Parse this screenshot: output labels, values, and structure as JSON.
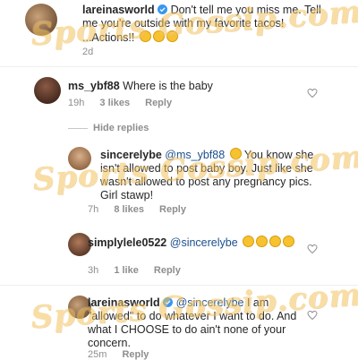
{
  "comments": [
    {
      "username": "lareinasworld",
      "text": "Don't tell me you miss me. Tell me you're outside with my favorite tacos! ...Actions!!",
      "time": "2d"
    },
    {
      "username": "ms_ybf88",
      "text": "Where is the baby",
      "time": "19h",
      "likes": "3 likes",
      "reply": "Reply"
    }
  ],
  "hide_replies": "Hide replies",
  "replies": [
    {
      "username": "sincerelybe",
      "mention": "@ms_ybf88",
      "text": "You know she isn't allowed to post baby boy. Just like she wasn't allowed to post any pregnancy pics. Girl stawp!",
      "time": "7h",
      "likes": "8 likes",
      "reply": "Reply"
    },
    {
      "username": "simplylele0522",
      "mention": "@sincerelybe",
      "time": "3h",
      "likes": "1 like",
      "reply": "Reply"
    },
    {
      "username": "lareinasworld",
      "mention": "@sincerelybe",
      "text": "I am \"allowed\" to do whatever I want to do. And what I CHOOSE to do ain't none of your concern.",
      "time": "25m",
      "reply": "Reply"
    }
  ],
  "watermark": "Sports Gossip.com",
  "icons": [
    "heart-icon",
    "verified-badge-icon",
    "emoji-icon"
  ]
}
